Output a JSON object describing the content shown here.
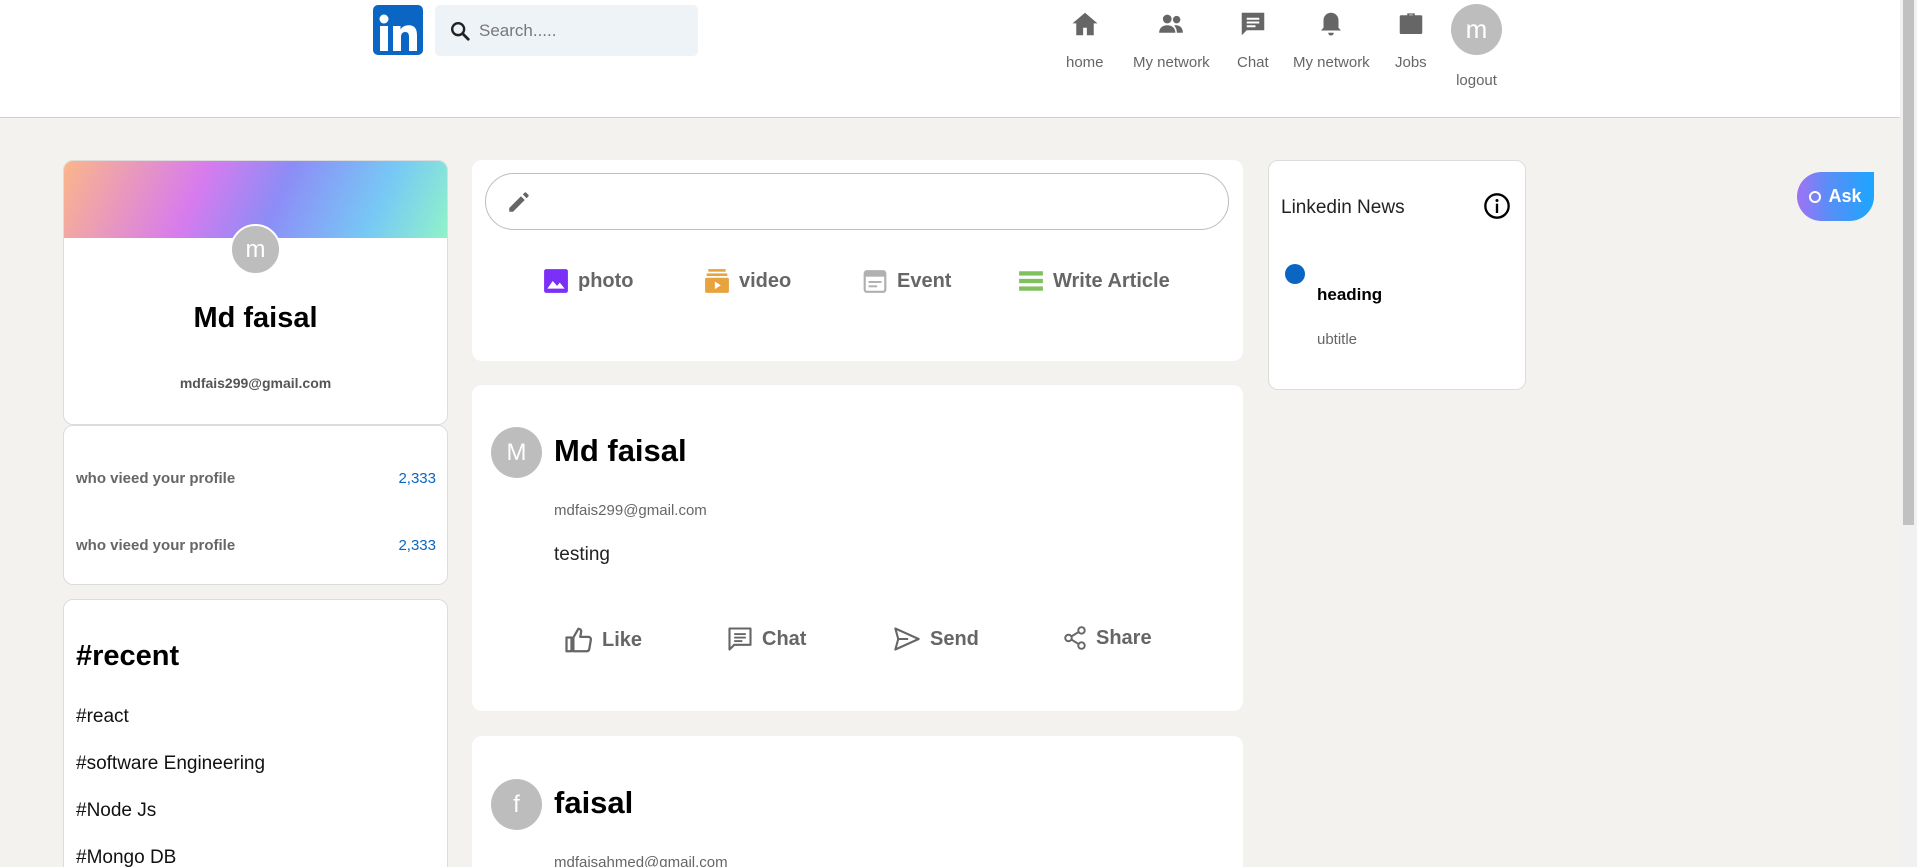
{
  "header": {
    "logo_text": "in",
    "search": {
      "placeholder": "Search....."
    },
    "nav": [
      {
        "label": "home",
        "icon": "home-icon"
      },
      {
        "label": "My network",
        "icon": "people-icon"
      },
      {
        "label": "Chat",
        "icon": "chat-icon"
      },
      {
        "label": "My network",
        "icon": "bell-icon"
      },
      {
        "label": "Jobs",
        "icon": "briefcase-icon"
      }
    ],
    "user_initial": "m",
    "logout_label": "logout"
  },
  "profile": {
    "initial": "m",
    "name": "Md faisal",
    "email": "mdfais299@gmail.com"
  },
  "stats": [
    {
      "label": "who vieed your profile",
      "value": "2,333"
    },
    {
      "label": "who vieed your profile",
      "value": "2,333"
    }
  ],
  "recent": {
    "title": "#recent",
    "items": [
      "#react",
      "#software Engineering",
      "#Node Js",
      "#Mongo DB"
    ]
  },
  "compose": {
    "actions": [
      {
        "label": "photo",
        "icon": "photo-icon",
        "color": "#7b2ff7"
      },
      {
        "label": "video",
        "icon": "video-icon",
        "color": "#e7a33e"
      },
      {
        "label": "Event",
        "icon": "calendar-icon",
        "color": "#b0b0b0"
      },
      {
        "label": "Write Article",
        "icon": "article-icon",
        "color": "#7fc15e"
      }
    ]
  },
  "posts": [
    {
      "initial": "M",
      "name": "Md faisal",
      "email": "mdfais299@gmail.com",
      "text": "testing",
      "actions": [
        "Like",
        "Chat",
        "Send",
        "Share"
      ]
    },
    {
      "initial": "f",
      "name": "faisal",
      "email": "mdfaisahmed@gmail.com"
    }
  ],
  "news": {
    "title": "Linkedin News",
    "items": [
      {
        "heading": "heading",
        "subtitle": "ubtitle"
      }
    ]
  },
  "ask_label": "Ask",
  "colors": {
    "brand": "#0a66c2",
    "background": "#f3f2ef"
  }
}
